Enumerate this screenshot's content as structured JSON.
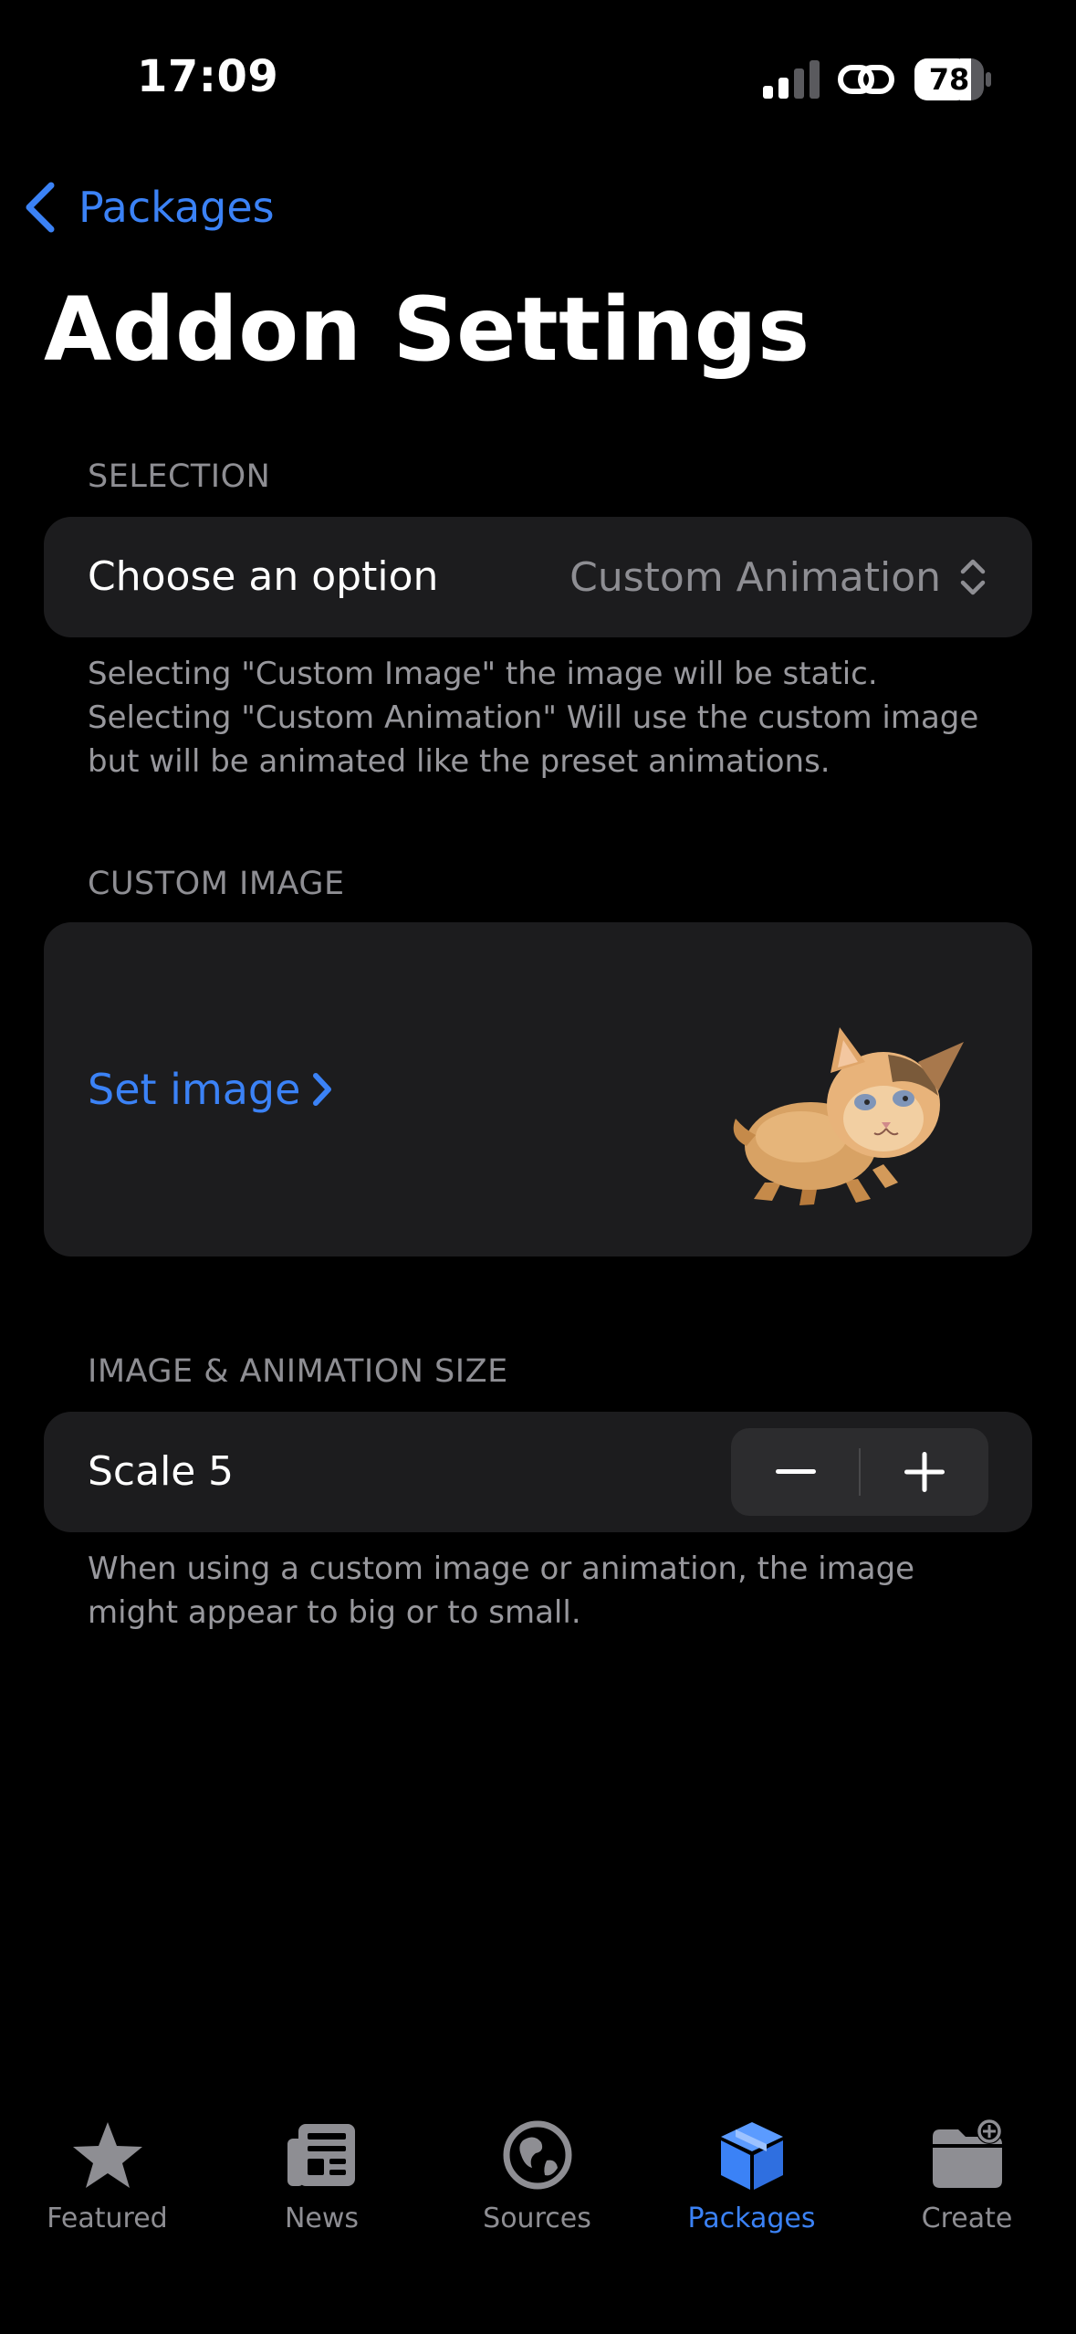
{
  "status_bar": {
    "time": "17:09",
    "battery": "78"
  },
  "nav": {
    "back_label": "Packages",
    "title": "Addon Settings"
  },
  "selection": {
    "header": "SELECTION",
    "label": "Choose an option",
    "value": "Custom Animation",
    "footer": "Selecting \"Custom Image\" the image will be static. Selecting \"Custom Animation\" Will use the custom image but will be animated like the preset animations."
  },
  "custom_image": {
    "header": "CUSTOM IMAGE",
    "link_label": "Set image"
  },
  "size": {
    "header": "IMAGE & ANIMATION SIZE",
    "label": "Scale",
    "value": "5",
    "footer": "When using a custom image or animation, the image might appear to big or to small."
  },
  "tab_bar": {
    "tabs": [
      {
        "label": "Featured",
        "icon": "star-icon"
      },
      {
        "label": "News",
        "icon": "newspaper-icon"
      },
      {
        "label": "Sources",
        "icon": "globe-icon"
      },
      {
        "label": "Packages",
        "icon": "box-icon"
      },
      {
        "label": "Create",
        "icon": "folder-plus-icon"
      }
    ],
    "active": "Packages"
  },
  "colors": {
    "accent": "#3b82f6",
    "background": "#000000",
    "card": "#1c1c1e",
    "secondary_text": "#8e8e93"
  }
}
